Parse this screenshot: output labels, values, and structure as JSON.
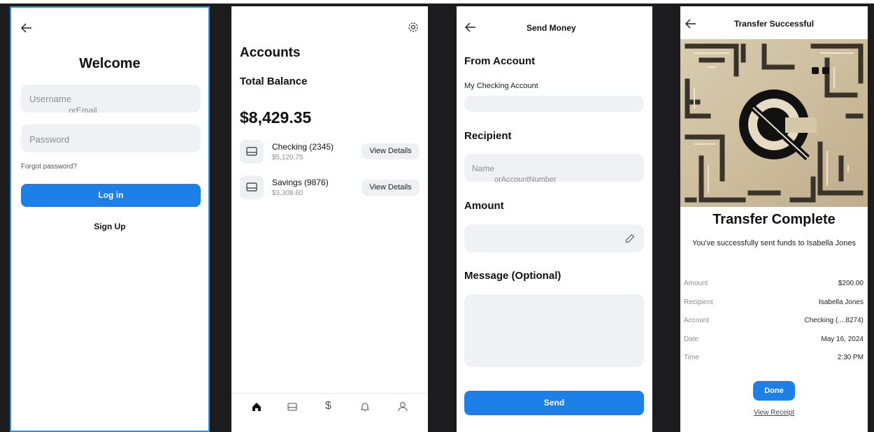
{
  "login": {
    "title": "Welcome",
    "username_placeholder": "Username",
    "username_placeholder_cont": "orEmail",
    "password_placeholder": "Password",
    "forgot_password": "Forgot password?",
    "login_button": "Log in",
    "signup_link": "Sign Up"
  },
  "accounts": {
    "title": "Accounts",
    "total_label": "Total Balance",
    "total_value": "$8,429.35",
    "items": [
      {
        "name": "Checking (2345)",
        "balance": "$5,120.75",
        "action": "View Details"
      },
      {
        "name": "Savings (9876)",
        "balance": "$3,308.60",
        "action": "View Details"
      }
    ],
    "nav": [
      "home-icon",
      "card-icon",
      "dollar-icon",
      "bell-icon",
      "user-icon"
    ]
  },
  "send": {
    "title": "Send Money",
    "from_label": "From Account",
    "from_value": "My Checking Account",
    "recipient_label": "Recipient",
    "recipient_placeholder": "Name",
    "recipient_placeholder_cont": "orAccountNumber",
    "amount_label": "Amount",
    "message_label": "Message (Optional)",
    "send_button": "Send"
  },
  "success": {
    "title": "Transfer Successful",
    "heading": "Transfer Complete",
    "message": "You've successfully sent funds to Isabella Jones",
    "details": [
      {
        "label": "Amount",
        "value": "$200.00"
      },
      {
        "label": "Recipient",
        "value": "Isabella Jones"
      },
      {
        "label": "Account",
        "value": "Checking (....8274)"
      },
      {
        "label": "Date",
        "value": "May 16, 2024"
      },
      {
        "label": "Time",
        "value": "2:30 PM"
      }
    ],
    "done_button": "Done",
    "receipt_link": "View Receipt"
  },
  "colors": {
    "accent": "#1d7fe8",
    "field_bg": "#f0f1f4",
    "frame_bg": "#1c1c1e"
  }
}
